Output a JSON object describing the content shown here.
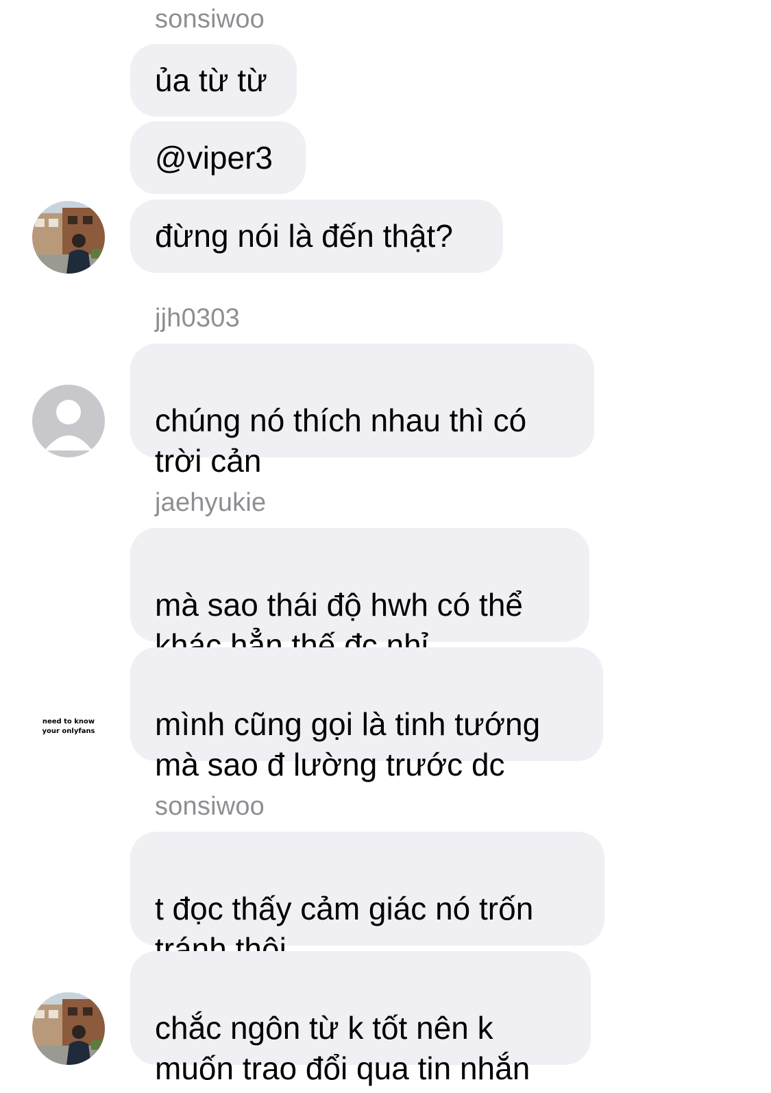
{
  "thread": {
    "groups": [
      {
        "sender": "sonsiwoo",
        "messages": [
          "ủa từ từ",
          "@viper3",
          "đừng nói là đến thật?"
        ]
      },
      {
        "sender": "jjh0303",
        "messages": [
          "chúng nó thích nhau thì có\ntrời cản"
        ]
      },
      {
        "sender": "jaehyukie",
        "messages": [
          "mà sao thái độ hwh có thể\nkhác hẳn thế đc nhỉ",
          "mình cũng gọi là tinh tướng\nmà sao đ lường trước dc"
        ],
        "avatar_text": [
          "need to know",
          "your onlyfans"
        ]
      },
      {
        "sender": "sonsiwoo",
        "messages": [
          "t đọc thấy cảm giác nó trốn\ntránh thôi",
          "chắc ngôn từ k tốt nên k\nmuốn trao đổi qua tin nhắn"
        ]
      }
    ]
  },
  "colors": {
    "bubble": "#efeff4",
    "sender": "#8e8e93",
    "text": "#000000"
  },
  "icons": {
    "photo_avatar": "user-photo-avatar-icon",
    "default_avatar": "default-user-avatar-icon"
  }
}
